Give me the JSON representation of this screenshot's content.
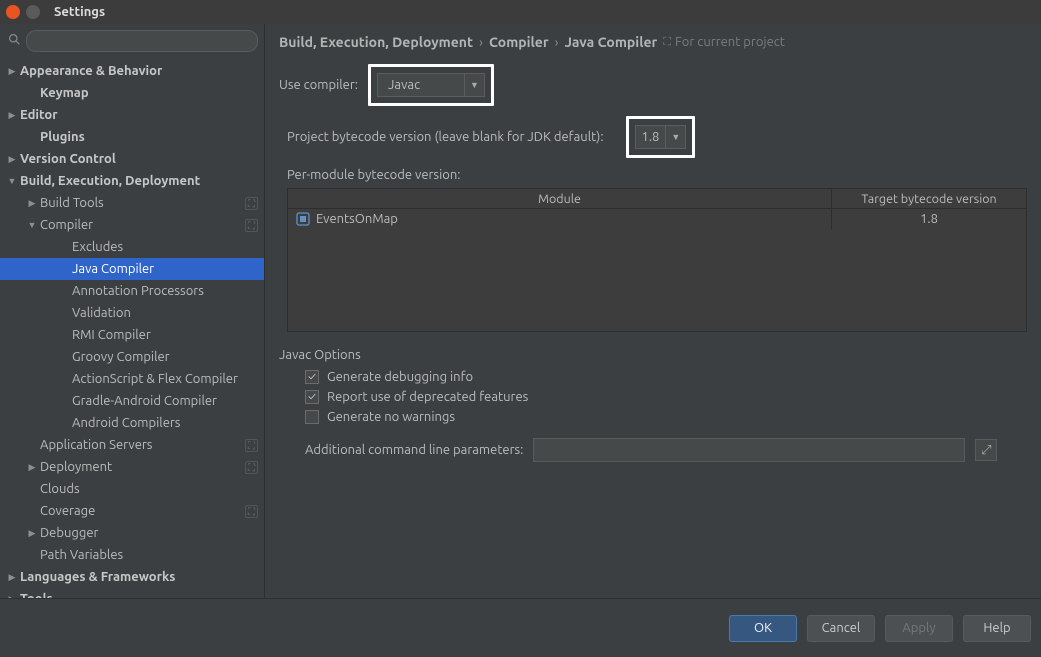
{
  "titlebar": {
    "title": "Settings"
  },
  "search": {
    "placeholder": ""
  },
  "sidebar": {
    "items": [
      {
        "label": "Appearance & Behavior",
        "depth": 0,
        "exp": "▶",
        "bold": true
      },
      {
        "label": "Keymap",
        "depth": 1,
        "exp": "",
        "bold": true
      },
      {
        "label": "Editor",
        "depth": 0,
        "exp": "▶",
        "bold": true
      },
      {
        "label": "Plugins",
        "depth": 1,
        "exp": "",
        "bold": true
      },
      {
        "label": "Version Control",
        "depth": 0,
        "exp": "▶",
        "bold": true
      },
      {
        "label": "Build, Execution, Deployment",
        "depth": 0,
        "exp": "▼",
        "bold": true
      },
      {
        "label": "Build Tools",
        "depth": 1,
        "exp": "▶",
        "bold": false,
        "proj": true
      },
      {
        "label": "Compiler",
        "depth": 1,
        "exp": "▼",
        "bold": false,
        "proj": true
      },
      {
        "label": "Excludes",
        "depth": 3,
        "exp": "",
        "bold": false
      },
      {
        "label": "Java Compiler",
        "depth": 3,
        "exp": "",
        "bold": false,
        "selected": true
      },
      {
        "label": "Annotation Processors",
        "depth": 3,
        "exp": "",
        "bold": false
      },
      {
        "label": "Validation",
        "depth": 3,
        "exp": "",
        "bold": false
      },
      {
        "label": "RMI Compiler",
        "depth": 3,
        "exp": "",
        "bold": false
      },
      {
        "label": "Groovy Compiler",
        "depth": 3,
        "exp": "",
        "bold": false
      },
      {
        "label": "ActionScript & Flex Compiler",
        "depth": 3,
        "exp": "",
        "bold": false
      },
      {
        "label": "Gradle-Android Compiler",
        "depth": 3,
        "exp": "",
        "bold": false
      },
      {
        "label": "Android Compilers",
        "depth": 3,
        "exp": "",
        "bold": false
      },
      {
        "label": "Application Servers",
        "depth": 1,
        "exp": "",
        "bold": false,
        "proj": true
      },
      {
        "label": "Deployment",
        "depth": 1,
        "exp": "▶",
        "bold": false,
        "proj": true
      },
      {
        "label": "Clouds",
        "depth": 1,
        "exp": "",
        "bold": false
      },
      {
        "label": "Coverage",
        "depth": 1,
        "exp": "",
        "bold": false,
        "proj": true
      },
      {
        "label": "Debugger",
        "depth": 1,
        "exp": "▶",
        "bold": false
      },
      {
        "label": "Path Variables",
        "depth": 1,
        "exp": "",
        "bold": false
      },
      {
        "label": "Languages & Frameworks",
        "depth": 0,
        "exp": "▶",
        "bold": true
      },
      {
        "label": "Tools",
        "depth": 0,
        "exp": "▶",
        "bold": true
      }
    ]
  },
  "breadcrumb": {
    "p1": "Build, Execution, Deployment",
    "p2": "Compiler",
    "p3": "Java Compiler",
    "scope": "For current project"
  },
  "main": {
    "use_compiler_label": "Use compiler:",
    "use_compiler_value": "Javac",
    "proj_bytecode_label": "Project bytecode version (leave blank for JDK default):",
    "proj_bytecode_value": "1.8",
    "per_module_label": "Per-module bytecode version:",
    "col_module": "Module",
    "col_target": "Target bytecode version",
    "module_name": "EventsOnMap",
    "module_target": "1.8",
    "javac_header": "Javac Options",
    "chk1": "Generate debugging info",
    "chk2": "Report use of deprecated features",
    "chk3": "Generate no warnings",
    "addl_label": "Additional command line parameters:"
  },
  "buttons": {
    "ok": "OK",
    "cancel": "Cancel",
    "apply": "Apply",
    "help": "Help"
  }
}
